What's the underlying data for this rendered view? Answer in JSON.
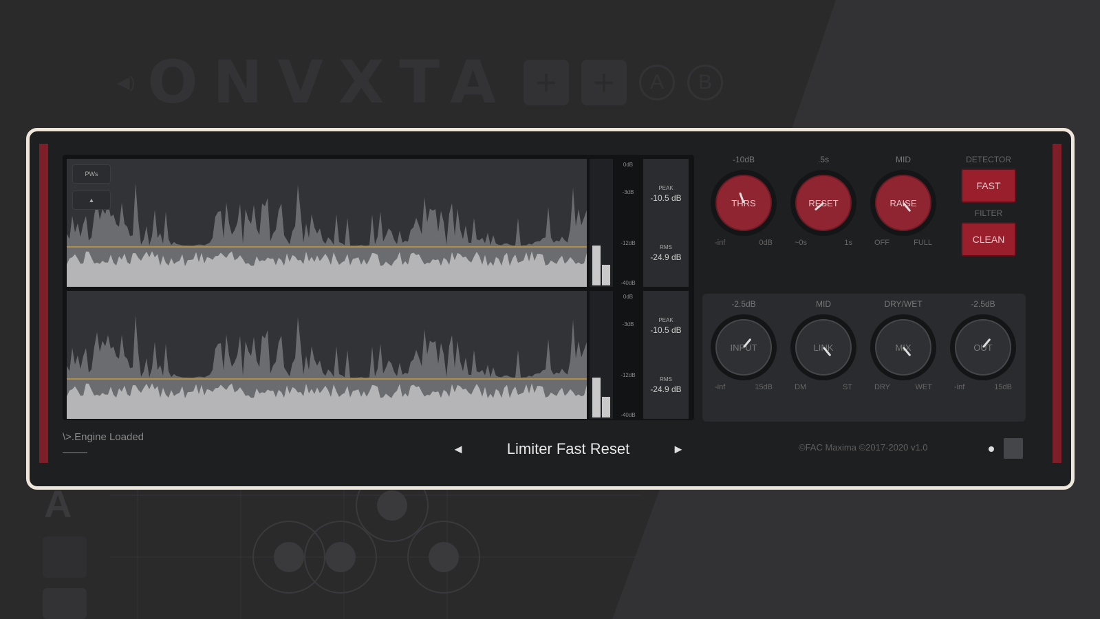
{
  "background": {
    "logo_text": "ONVXTA",
    "plus": "+",
    "ab": [
      "A",
      "B"
    ],
    "bottom_letter": "A"
  },
  "display": {
    "buttons": [
      {
        "label": "PWs"
      },
      {
        "label": "▲"
      }
    ],
    "scale": [
      "0dB",
      "-3dB",
      "-12dB",
      "-40dB"
    ],
    "channels": [
      {
        "peak_label": "PEAK",
        "peak": "-10.5 dB",
        "rms_label": "RMS",
        "rms": "-24.9 dB"
      },
      {
        "peak_label": "PEAK",
        "peak": "-10.5 dB",
        "rms_label": "RMS",
        "rms": "-24.9 dB"
      }
    ]
  },
  "top_knobs": [
    {
      "top": "-10dB",
      "label": "THRS",
      "min": "-inf",
      "max": "0dB"
    },
    {
      "top": ".5s",
      "label": "RESET",
      "min": "~0s",
      "max": "1s"
    },
    {
      "top": "MID",
      "label": "RAISE",
      "min": "OFF",
      "max": "FULL"
    }
  ],
  "detector": {
    "label": "DETECTOR",
    "button": "FAST",
    "filter_label": "FILTER",
    "filter_button": "CLEAN"
  },
  "bottom_knobs": [
    {
      "top": "-2.5dB",
      "label": "INPUT",
      "min": "-inf",
      "max": "15dB"
    },
    {
      "top": "MID",
      "label": "LINK",
      "min": "DM",
      "max": "ST"
    },
    {
      "top": "DRY/WET",
      "label": "MIX",
      "min": "DRY",
      "max": "WET"
    },
    {
      "top": "-2.5dB",
      "label": "OUT",
      "min": "-inf",
      "max": "15dB"
    }
  ],
  "footer": {
    "status": "\\>.Engine Loaded",
    "prev": "◄",
    "preset": "Limiter Fast Reset",
    "next": "►",
    "version": "©FAC Maxima ©2017-2020 v1.0"
  },
  "colors": {
    "accent": "#8e2531",
    "threshold_line": "#c89a3a",
    "frame": "#eee6da"
  }
}
